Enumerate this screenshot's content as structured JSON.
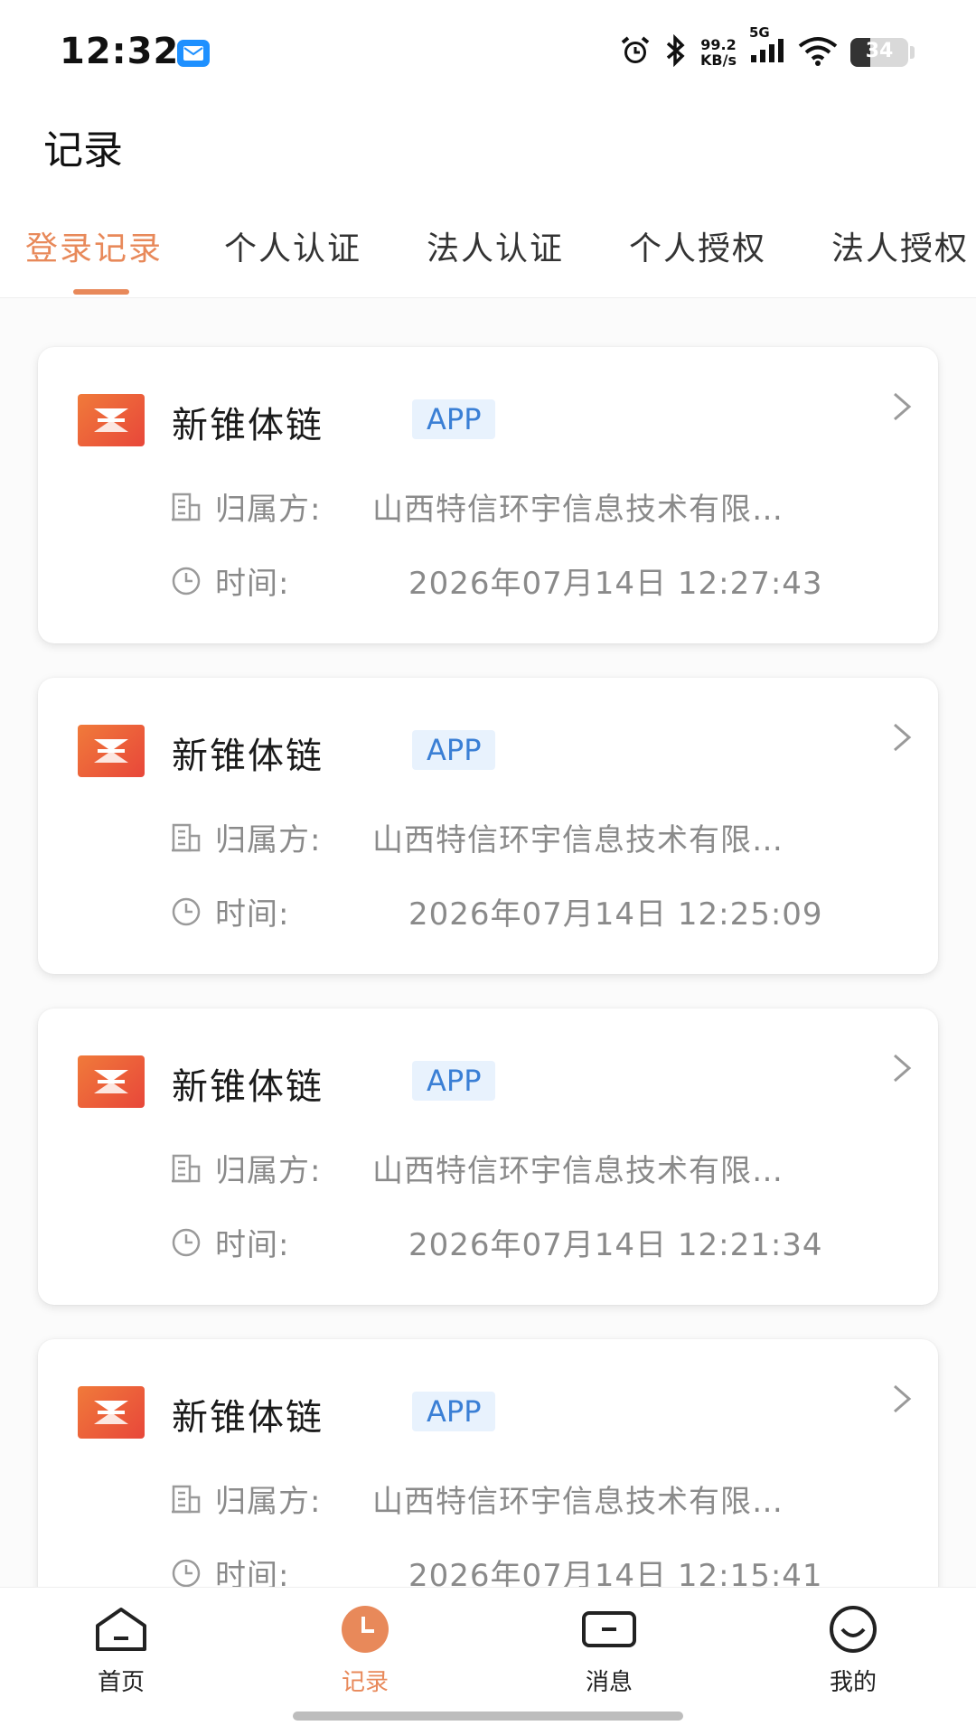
{
  "status_bar": {
    "time": "12:32",
    "net_speed_value": "99.2",
    "net_speed_unit": "KB/s",
    "network": "5G",
    "battery": "34",
    "battery_level_percent": 34
  },
  "header": {
    "title": "记录"
  },
  "tabs": [
    {
      "label": "登录记录",
      "active": true
    },
    {
      "label": "个人认证"
    },
    {
      "label": "法人认证"
    },
    {
      "label": "个人授权"
    },
    {
      "label": "法人授权"
    }
  ],
  "records": [
    {
      "name": "新锥体链",
      "tag": "APP",
      "owner_label": "归属方:",
      "owner": "山西特信环宇信息技术有限…",
      "time_label": "时间:",
      "time": "2026年07月14日 12:27:43"
    },
    {
      "name": "新锥体链",
      "tag": "APP",
      "owner_label": "归属方:",
      "owner": "山西特信环宇信息技术有限…",
      "time_label": "时间:",
      "time": "2026年07月14日 12:25:09"
    },
    {
      "name": "新锥体链",
      "tag": "APP",
      "owner_label": "归属方:",
      "owner": "山西特信环宇信息技术有限…",
      "time_label": "时间:",
      "time": "2026年07月14日 12:21:34"
    },
    {
      "name": "新锥体链",
      "tag": "APP",
      "owner_label": "归属方:",
      "owner": "山西特信环宇信息技术有限…",
      "time_label": "时间:",
      "time": "2026年07月14日 12:15:41"
    }
  ],
  "bottom_nav": [
    {
      "label": "首页",
      "icon": "home-icon"
    },
    {
      "label": "记录",
      "icon": "clock-icon",
      "active": true
    },
    {
      "label": "消息",
      "icon": "message-icon"
    },
    {
      "label": "我的",
      "icon": "smile-icon"
    }
  ],
  "colors": {
    "accent": "#e8895a",
    "tag_text": "#3a7fd5",
    "tag_bg": "#e8f2fd",
    "logo": "#e8473a"
  }
}
